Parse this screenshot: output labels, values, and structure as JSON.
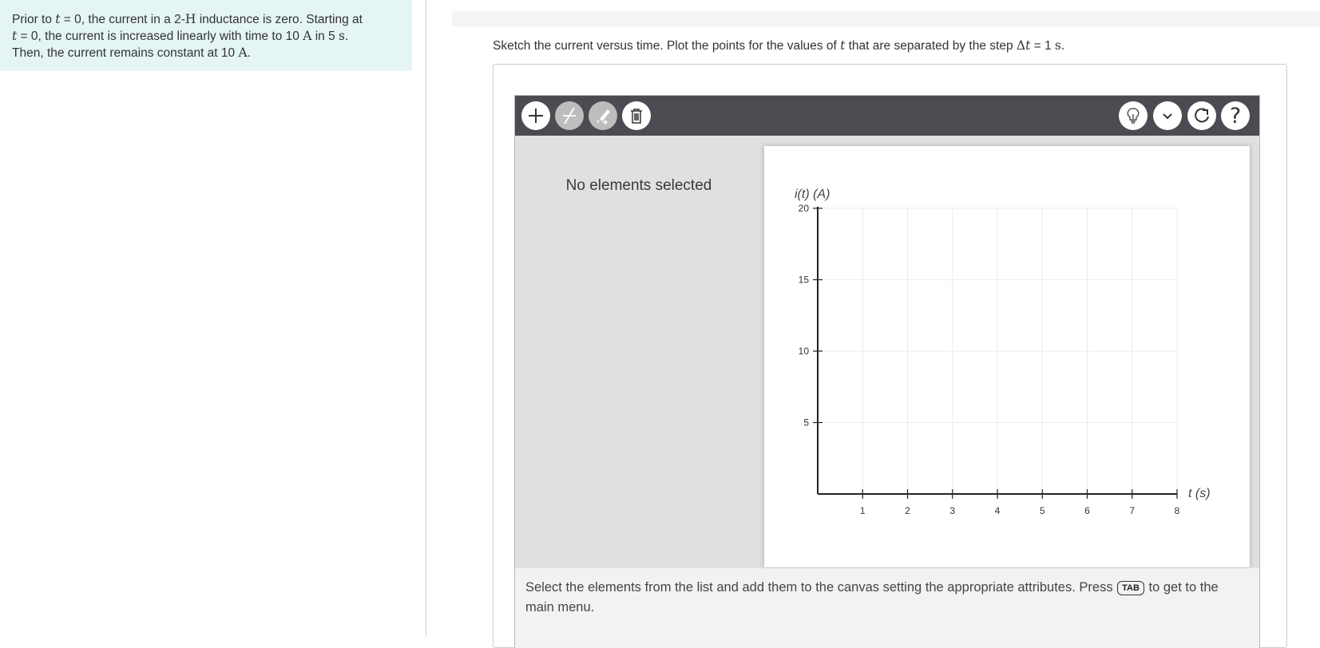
{
  "problem": {
    "t_symbol": "t",
    "seg1": "Prior to ",
    "seg2": " = 0, the current in a 2-",
    "unit_H": "H",
    "seg3": " inductance is zero. Starting at",
    "seg4": " = 0, the current is increased linearly with time to 10 ",
    "unit_A": "A",
    "seg5": " in 5 ",
    "unit_s": "s",
    "seg6": ".",
    "seg7": "Then, the current remains constant at 10 ",
    "seg8": "."
  },
  "instruction": {
    "part1": "Sketch the current versus time. Plot the points for the values of ",
    "t_symbol": "t",
    "part2": " that are separated by the step ",
    "delta": "Δ",
    "part3": " = 1 ",
    "unit_s": "s",
    "part4": "."
  },
  "toolbar": {
    "left_tools": [
      "add-tool",
      "line-tool",
      "edit-tool",
      "delete-tool"
    ],
    "right_tools": [
      "hint-tool",
      "expand-tool",
      "reset-tool",
      "help-tool"
    ],
    "help_glyph": "?"
  },
  "side_panel": {
    "status": "No elements selected"
  },
  "help": {
    "part1": "Select the elements from the list and add them to the canvas setting the appropriate attributes. Press ",
    "key": "TAB",
    "part2": " to get to the main menu."
  },
  "chart_data": {
    "type": "scatter",
    "title": "",
    "ylabel": "i(t) (A)",
    "xlabel": "t (s)",
    "xlim": [
      0,
      8
    ],
    "ylim": [
      0,
      20
    ],
    "x_ticks": [
      1,
      2,
      3,
      4,
      5,
      6,
      7,
      8
    ],
    "y_ticks": [
      5,
      10,
      15,
      20
    ],
    "grid": true,
    "series": []
  }
}
